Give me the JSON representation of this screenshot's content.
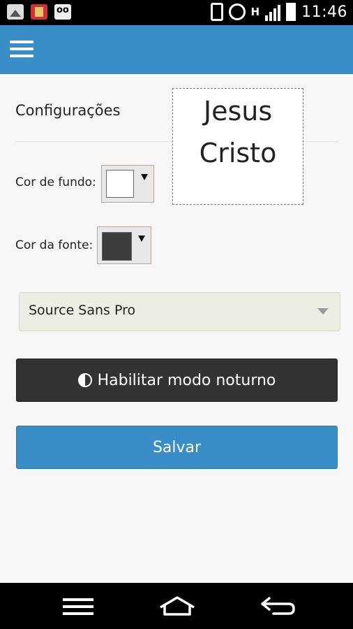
{
  "status_bar": {
    "time": "11:46",
    "network_label": "H",
    "left_icons": [
      "gallery-icon",
      "book-app-icon",
      "voicemail-icon"
    ],
    "right_icons": [
      "phone-vibrate-icon",
      "alarm-icon",
      "network-h-icon",
      "signal-icon",
      "battery-icon"
    ]
  },
  "header": {
    "menu_icon": "hamburger-menu-icon",
    "color": "#3a8ec7"
  },
  "settings": {
    "title": "Configurações",
    "preview_line1": "Jesus",
    "preview_line2": "Cristo",
    "background_color_label": "Cor de fundo:",
    "background_color_value": "#ffffff",
    "font_color_label": "Cor da fonte:",
    "font_color_value": "#3d3d3d",
    "font_select_value": "Source Sans Pro",
    "night_mode_button": "Habilitar modo noturno",
    "night_mode_icon": "contrast-icon",
    "save_button": "Salvar"
  },
  "nav_bar": {
    "icons": [
      "menu-icon",
      "home-icon",
      "back-icon"
    ]
  }
}
